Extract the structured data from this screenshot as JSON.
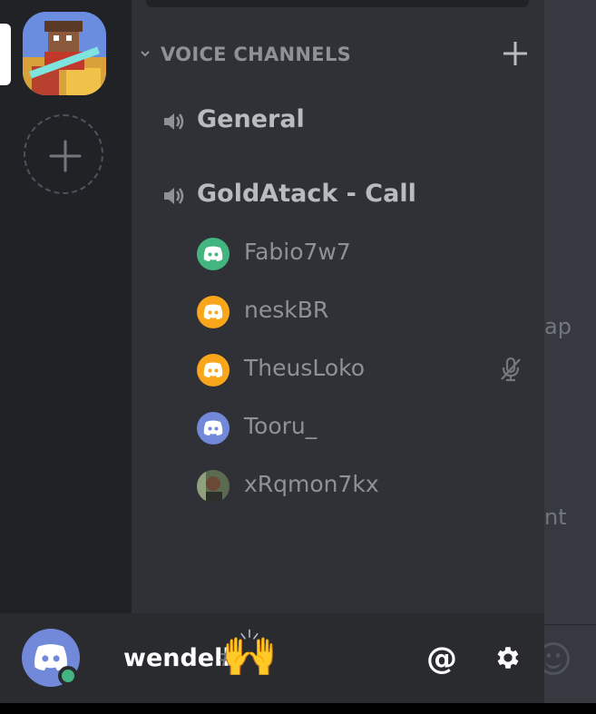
{
  "category": {
    "label": "VOICE CHANNELS"
  },
  "voice_channels": [
    {
      "name": "General"
    },
    {
      "name": "GoldAtack - Call"
    }
  ],
  "members": [
    {
      "name": "Fabio7w7",
      "avatar_color": "#43b581",
      "muted": false
    },
    {
      "name": "neskBR",
      "avatar_color": "#faa61a",
      "muted": false
    },
    {
      "name": "TheusLoko",
      "avatar_color": "#faa61a",
      "muted": true
    },
    {
      "name": "Tooru_",
      "avatar_color": "#7289da",
      "muted": false
    },
    {
      "name": "xRqmon7kx",
      "avatar_color": "photo",
      "muted": false
    }
  ],
  "user": {
    "name": "wendell",
    "tag_prefix": "#",
    "wave_emoji": "🙌",
    "status": "online",
    "status_color": "#43b581"
  },
  "right_pane": {
    "peek_1": "ap",
    "peek_2": "nt"
  },
  "user_bar": {
    "mention_label": "@"
  },
  "icons": {
    "category_chevron": "chevron-down-icon",
    "add_channel": "plus-icon",
    "voice_channel": "speaker-icon",
    "mute": "microphone-muted-icon",
    "settings": "gear-icon",
    "emoji": "smiley-icon"
  },
  "colors": {
    "accent": "#7289da",
    "online": "#43b581",
    "idle": "#faa61a"
  }
}
